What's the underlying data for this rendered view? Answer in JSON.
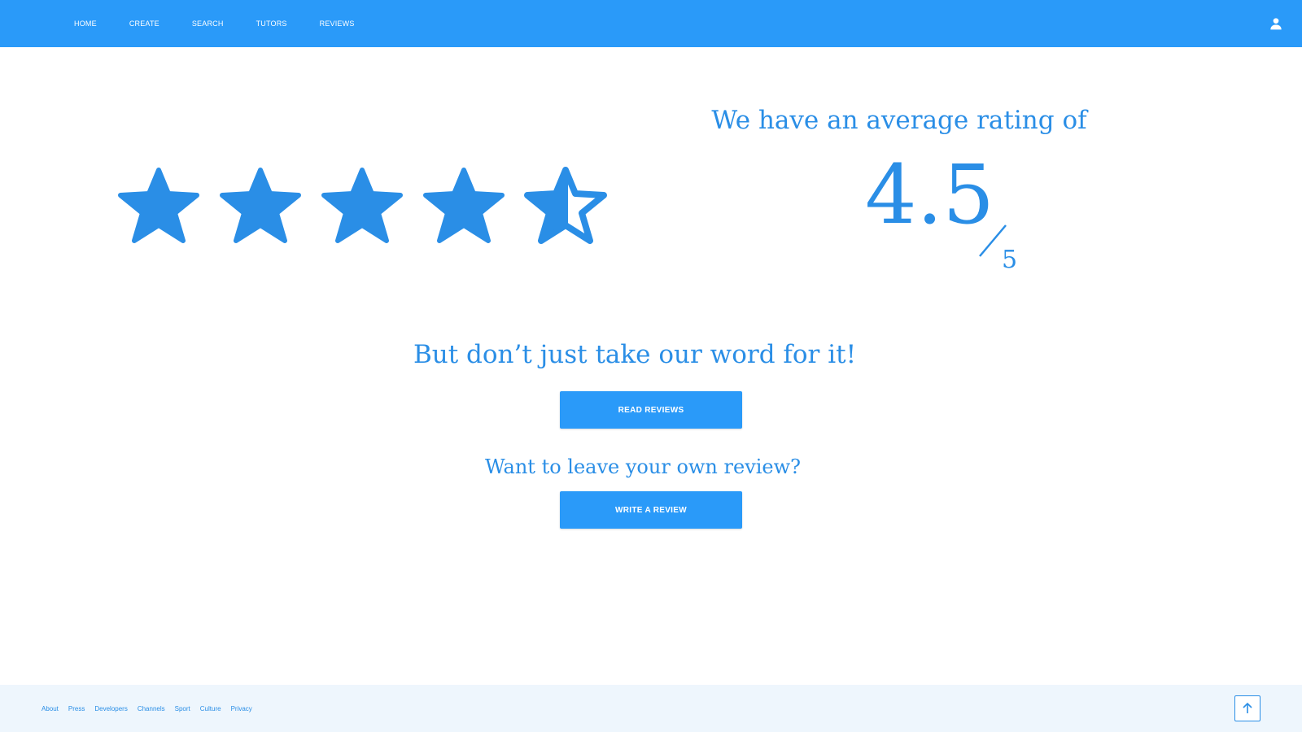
{
  "nav": {
    "items": [
      {
        "label": "HOME"
      },
      {
        "label": "CREATE"
      },
      {
        "label": "SEARCH"
      },
      {
        "label": "TUTORS"
      },
      {
        "label": "REVIEWS"
      }
    ],
    "user_icon": "user-icon"
  },
  "rating": {
    "heading": "We have an average rating of",
    "value": "4.5",
    "max": "5",
    "stars_filled": 4.5,
    "stars_total": 5
  },
  "cta": {
    "heading": "But don’t just take our word for it!",
    "read_button": "READ REVIEWS",
    "subheading": "Want to leave your own review?",
    "write_button": "WRITE A REVIEW"
  },
  "footer": {
    "links": [
      "About",
      "Press",
      "Developers",
      "Channels",
      "Sport",
      "Culture",
      "Privacy"
    ],
    "to_top_icon": "arrow-up-icon"
  },
  "colors": {
    "accent": "#2a9af9",
    "text_accent": "#2a8ee6",
    "footer_bg": "#eef6fd"
  }
}
